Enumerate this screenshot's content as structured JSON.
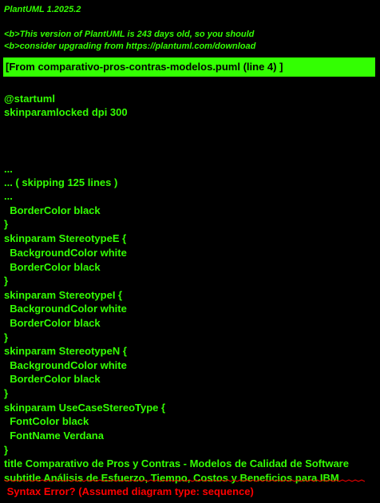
{
  "header": {
    "version": "PlantUML 1.2025.2",
    "notice_line1": "<b>This version of PlantUML is 243 days old, so you should",
    "notice_line2": "<b>consider upgrading from https://plantuml.com/download"
  },
  "source_reference": "[From comparativo-pros-contras-modelos.puml (line 4) ]",
  "code_lines": [
    "@startuml",
    "skinparamlocked dpi 300",
    "...",
    "... ( skipping 125 lines )",
    "...",
    "  BorderColor black",
    "}",
    "skinparam StereotypeE {",
    "  BackgroundColor white",
    "  BorderColor black",
    "}",
    "skinparam StereotypeI {",
    "  BackgroundColor white",
    "  BorderColor black",
    "}",
    "skinparam StereotypeN {",
    "  BackgroundColor white",
    "  BorderColor black",
    "}",
    "skinparam UseCaseStereoType {",
    "  FontColor black",
    "  FontName Verdana",
    "}",
    "title Comparativo de Pros y Contras - Modelos de Calidad de Software",
    "subtitle Análisis de Esfuerzo, Tiempo, Costos y Beneficios para IBM"
  ],
  "error_message": " Syntax Error? (Assumed diagram type: sequence)",
  "colors": {
    "background": "#000000",
    "text": "#33FF02",
    "highlight_bar": "#33FF02",
    "error": "#FF0000"
  }
}
